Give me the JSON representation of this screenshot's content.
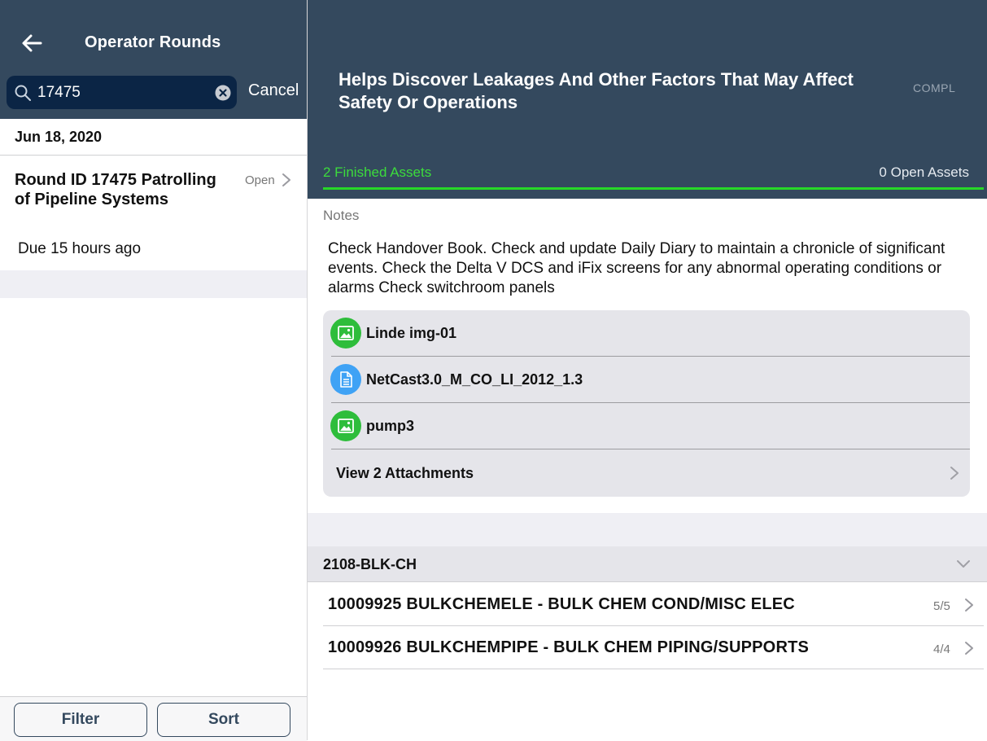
{
  "left": {
    "title": "Operator Rounds",
    "search": {
      "value": "17475",
      "cancel_label": "Cancel"
    },
    "date_header": "Jun 18, 2020",
    "round": {
      "title": "Round ID 17475 Patrolling of Pipeline Systems",
      "status": "Open",
      "due": "Due 15 hours ago"
    },
    "footer": {
      "filter_label": "Filter",
      "sort_label": "Sort"
    }
  },
  "right": {
    "title": "Helps Discover Leakages And Other Factors That May Affect Safety Or Operations",
    "status_short": "COMPL",
    "tabs": {
      "finished": "2 Finished Assets",
      "open": "0 Open Assets"
    },
    "notes_label": "Notes",
    "notes_text": "Check Handover Book. Check and update Daily Diary to maintain a chronicle of significant events. Check the Delta V DCS and iFix screens for any abnormal operating conditions or alarms Check switchroom panels",
    "attachments": [
      {
        "name": "Linde img-01",
        "icon": "image-icon",
        "color": "#2ebd3b"
      },
      {
        "name": "NetCast3.0_M_CO_LI_2012_1.3",
        "icon": "document-icon",
        "color": "#3fa2f5"
      },
      {
        "name": "pump3",
        "icon": "image-icon",
        "color": "#2ebd3b"
      }
    ],
    "view_attachments_label": "View 2 Attachments",
    "group": {
      "title": "2108-BLK-CH",
      "assets": [
        {
          "name": "10009925 BULKCHEMELE - BULK CHEM COND/MISC ELEC",
          "count": "5/5"
        },
        {
          "name": "10009926 BULKCHEMPIPE - BULK CHEM PIPING/SUPPORTS",
          "count": "4/4"
        }
      ]
    }
  },
  "colors": {
    "header": "#34495e",
    "accent_green": "#27d827",
    "search_bg": "#0b2545"
  }
}
